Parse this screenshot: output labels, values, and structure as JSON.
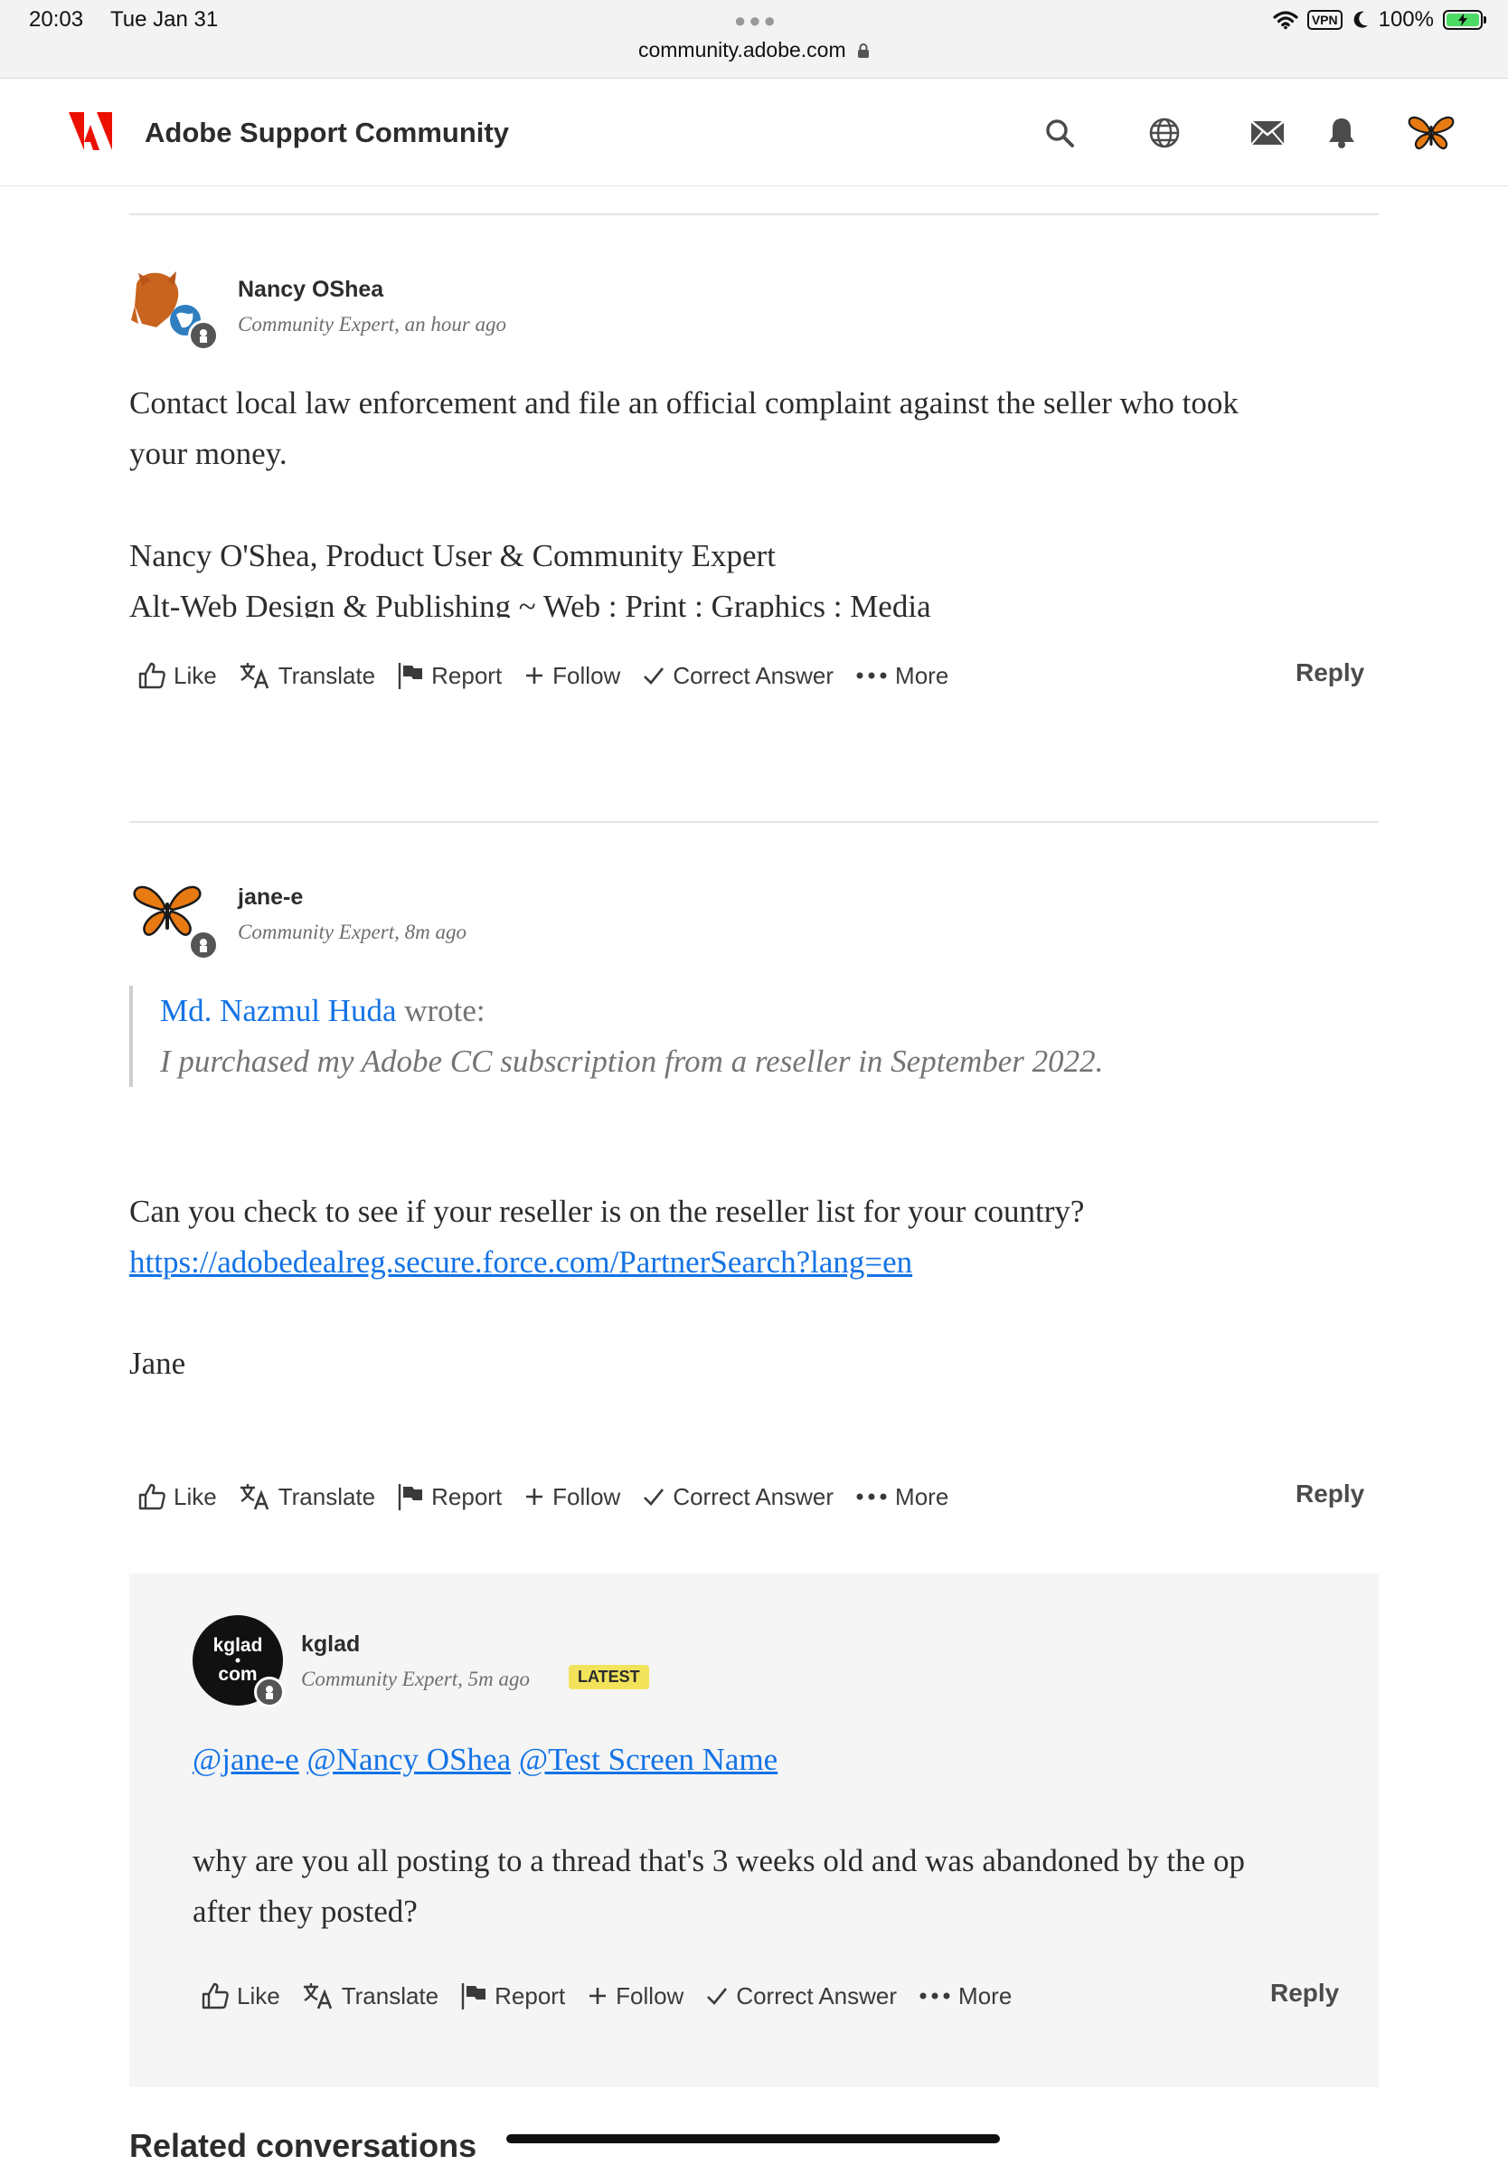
{
  "status_bar": {
    "time": "20:03",
    "date": "Tue Jan 31",
    "url": "community.adobe.com",
    "vpn": "VPN",
    "battery": "100%",
    "battery_level": 1.0
  },
  "header": {
    "site_title": "Adobe Support Community",
    "icons": [
      "adobe-logo-icon",
      "search-icon",
      "globe-icon",
      "mail-icon",
      "bell-icon",
      "butterfly-avatar-icon"
    ]
  },
  "actions": {
    "like": "Like",
    "translate": "Translate",
    "report": "Report",
    "follow": "Follow",
    "correct": "Correct Answer",
    "more": "More",
    "reply": "Reply"
  },
  "posts": [
    {
      "author": "Nancy OShea",
      "role": "Community Expert",
      "time": ", an hour ago",
      "body_line1": "Contact local law enforcement and file an official complaint against the seller who took",
      "body_line2": "your money.",
      "sig_line1": "Nancy O'Shea, Product User & Community Expert",
      "sig_line2": "Alt-Web Design & Publishing ~ Web : Print : Graphics : Media"
    },
    {
      "author": "jane-e",
      "role": "Community Expert",
      "time": ", 8m ago",
      "quote_author": "Md. Nazmul Huda",
      "quote_wrote": " wrote:",
      "quote_body": "I purchased my Adobe CC subscription from a reseller in September 2022.",
      "body_line1": "Can you check to see if your reseller is on the reseller list for your country?",
      "link": "https://adobedealreg.secure.force.com/PartnerSearch?lang=en",
      "sign": "Jane"
    },
    {
      "author": "kglad",
      "avatar_text1": "kglad",
      "avatar_text2": "com",
      "role": "Community Expert",
      "time": ", 5m ago",
      "badge": "LATEST",
      "mention1": "@jane-e",
      "mention2": "@Nancy OShea",
      "mention3": "@Test Screen Name",
      "body_line1": "why are you all posting to a thread that's 3 weeks old and was abandoned by the op",
      "body_line2": "after they posted?"
    }
  ],
  "related_heading": "Related conversations"
}
